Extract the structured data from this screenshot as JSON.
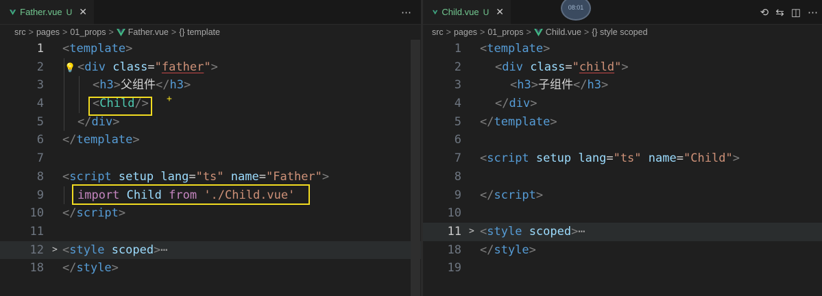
{
  "left": {
    "tab": {
      "filename": "Father.vue",
      "status": "U",
      "close": "✕",
      "more": "⋯"
    },
    "breadcrumb": {
      "src": "src",
      "pages": "pages",
      "folder": "01_props",
      "file": "Father.vue",
      "symbol": "{} template"
    },
    "lines": [
      {
        "num": "1"
      },
      {
        "num": "2"
      },
      {
        "num": "3"
      },
      {
        "num": "4"
      },
      {
        "num": "5"
      },
      {
        "num": "6"
      },
      {
        "num": "7"
      },
      {
        "num": "8"
      },
      {
        "num": "9"
      },
      {
        "num": "10"
      },
      {
        "num": "11"
      },
      {
        "num": "12"
      },
      {
        "num": "18"
      }
    ],
    "code": {
      "template_open": "template",
      "div_tag": "div",
      "class_attr": "class",
      "father_class": "father",
      "h3_tag": "h3",
      "heading": "父组件",
      "child_tag": "Child",
      "div_close": "div",
      "template_close": "template",
      "script_tag": "script",
      "setup": "setup",
      "lang_attr": "lang",
      "lang_val": "ts",
      "name_attr": "name",
      "name_val": "Father",
      "import_kw": "import",
      "import_name": "Child",
      "from_kw": "from",
      "import_path": "'./Child.vue'",
      "script_close": "script",
      "style_tag": "style",
      "scoped": "scoped",
      "ellipsis": "⋯",
      "style_close": "style"
    }
  },
  "right": {
    "tab": {
      "filename": "Child.vue",
      "status": "U",
      "close": "✕"
    },
    "timer": "08:01",
    "breadcrumb": {
      "src": "src",
      "pages": "pages",
      "folder": "01_props",
      "file": "Child.vue",
      "symbol": "{} style scoped"
    },
    "lines": [
      {
        "num": "1"
      },
      {
        "num": "2"
      },
      {
        "num": "3"
      },
      {
        "num": "4"
      },
      {
        "num": "5"
      },
      {
        "num": "6"
      },
      {
        "num": "7"
      },
      {
        "num": "8"
      },
      {
        "num": "9"
      },
      {
        "num": "10"
      },
      {
        "num": "11"
      },
      {
        "num": "18"
      },
      {
        "num": "19"
      }
    ],
    "code": {
      "template_open": "template",
      "div_tag": "div",
      "class_attr": "class",
      "child_class": "child",
      "h3_tag": "h3",
      "heading": "子组件",
      "div_close": "div",
      "template_close": "template",
      "script_tag": "script",
      "setup": "setup",
      "lang_attr": "lang",
      "lang_val": "ts",
      "name_attr": "name",
      "name_val": "Child",
      "script_close": "script",
      "style_tag": "style",
      "scoped": "scoped",
      "ellipsis": "⋯",
      "style_close": "style"
    },
    "actions": {
      "timeline": "⟲",
      "compare": "⇆",
      "split": "◫",
      "more": "⋯"
    }
  },
  "colors": {
    "tag": "#569cd6",
    "attr": "#9cdcfe",
    "string": "#ce9178",
    "keyword": "#c586c0",
    "component": "#4ec9b0",
    "highlight_box": "#f2dc21",
    "vue_green": "#41b883"
  }
}
